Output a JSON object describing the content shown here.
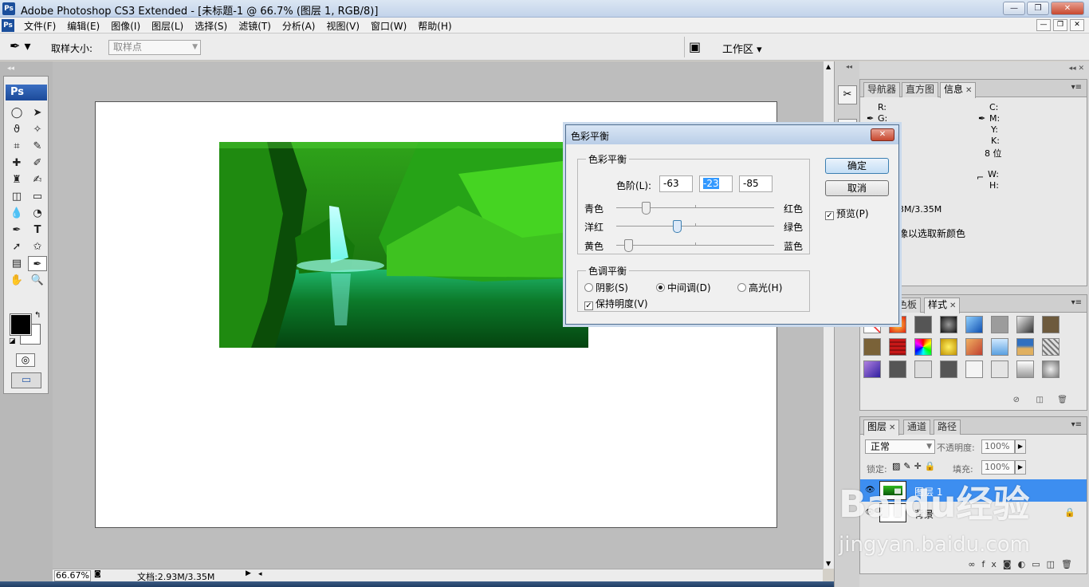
{
  "window": {
    "app_icon": "Ps",
    "title": "Adobe Photoshop CS3 Extended - [未标题-1 @ 66.7% (图层 1, RGB/8)]"
  },
  "menu": {
    "items": [
      "文件(F)",
      "编辑(E)",
      "图像(I)",
      "图层(L)",
      "选择(S)",
      "滤镜(T)",
      "分析(A)",
      "视图(V)",
      "窗口(W)",
      "帮助(H)"
    ]
  },
  "options_bar": {
    "sample_size_label": "取样大小:",
    "sample_size_value": "取样点",
    "workspace_label": "工作区 ▾"
  },
  "toolbox": {
    "header": "Ps",
    "foreground_color": "#000000",
    "background_color": "#ffffff"
  },
  "status": {
    "zoom": "66.67%",
    "doc": "文档:2.93M/3.35M"
  },
  "panels": {
    "info": {
      "tabs": [
        "导航器",
        "直方图",
        "信息"
      ],
      "active_tab": "信息",
      "labels": {
        "r": "R:",
        "g": "G:",
        "c": "C:",
        "m": "M:",
        "y": "Y:",
        "k": "K:",
        "bits": "8 位",
        "w": "W:",
        "h": "H:"
      },
      "doc_size": "3M/3.35M",
      "hint": "像以选取新颜色"
    },
    "styles": {
      "tabs": [
        "色板",
        "样式"
      ],
      "active_tab": "样式"
    },
    "layers": {
      "tabs": [
        "图层",
        "通道",
        "路径"
      ],
      "active_tab": "图层",
      "blend_mode": "正常",
      "opacity_label": "不透明度:",
      "opacity_value": "100%",
      "lock_label": "锁定:",
      "fill_label": "填充:",
      "fill_value": "100%",
      "rows": [
        {
          "name": "图层 1",
          "selected": true
        },
        {
          "name": "背景",
          "selected": false
        }
      ]
    }
  },
  "dialog": {
    "title": "色彩平衡",
    "color_balance_group": "色彩平衡",
    "levels_label": "色阶(L):",
    "levels": [
      -63,
      -23,
      -85
    ],
    "sliders": [
      {
        "left": "青色",
        "right": "红色",
        "value": -63
      },
      {
        "left": "洋红",
        "right": "绿色",
        "value": -23
      },
      {
        "left": "黄色",
        "right": "蓝色",
        "value": -85
      }
    ],
    "tone_group": "色调平衡",
    "tones": [
      {
        "label": "阴影(S)",
        "checked": false
      },
      {
        "label": "中间调(D)",
        "checked": true
      },
      {
        "label": "高光(H)",
        "checked": false
      }
    ],
    "preserve_luminosity": "保持明度(V)",
    "ok": "确定",
    "cancel": "取消",
    "preview": "预览(P)"
  },
  "watermark": {
    "brand": "Baidu经验",
    "url": "jingyan.baidu.com"
  }
}
